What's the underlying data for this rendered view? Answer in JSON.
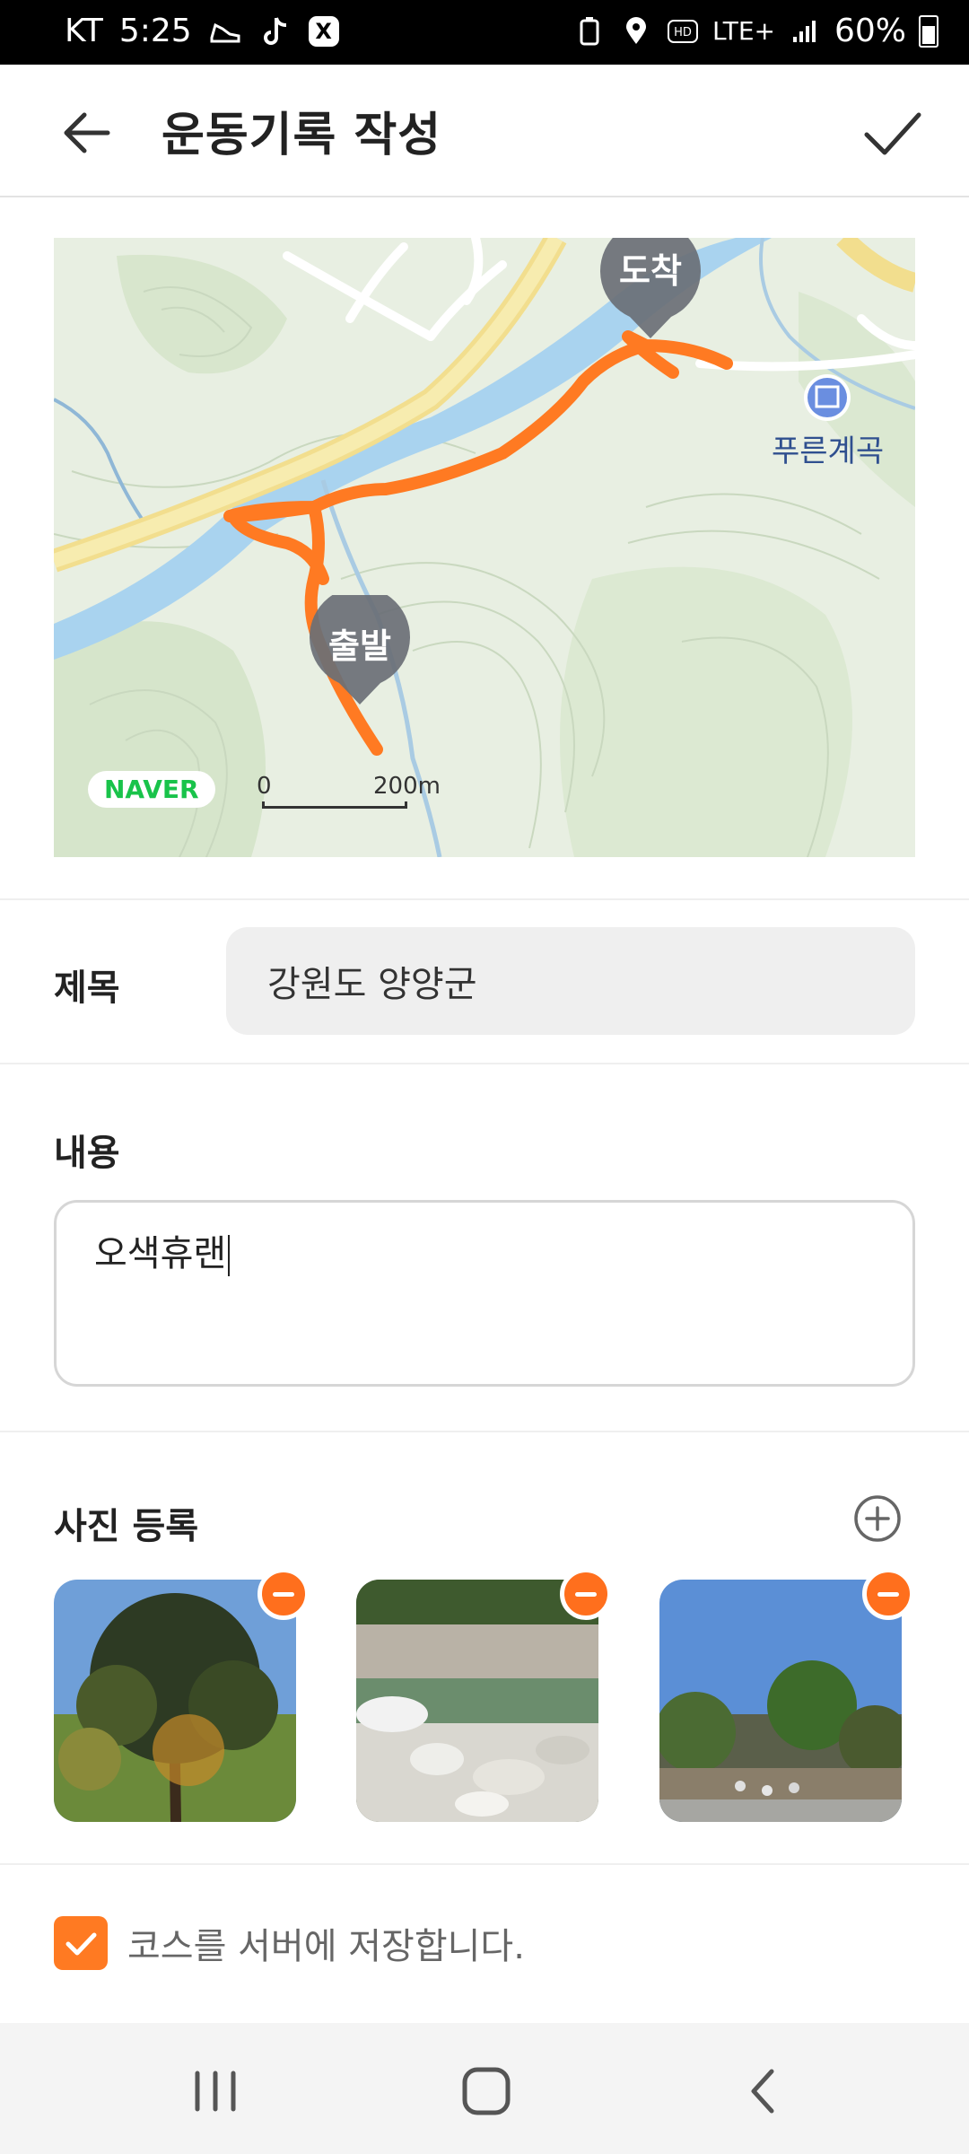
{
  "status_bar": {
    "carrier": "KT",
    "time": "5:25",
    "network": "LTE+",
    "battery": "60%"
  },
  "header": {
    "title": "운동기록 작성"
  },
  "map": {
    "start_label": "출발",
    "end_label": "도착",
    "place_label": "푸른계곡",
    "brand": "NAVER",
    "scale_zero": "0",
    "scale_distance": "200m",
    "route_color": "#ff7a22"
  },
  "form": {
    "title_label": "제목",
    "title_value": "강원도 양양군",
    "content_label": "내용",
    "content_value": "오색휴랜",
    "photo_label": "사진 등록",
    "save_course_label": "코스를 서버에 저장합니다.",
    "save_course_checked": true
  },
  "colors": {
    "accent": "#ff7a22",
    "remove_badge": "#ff6f1d"
  }
}
